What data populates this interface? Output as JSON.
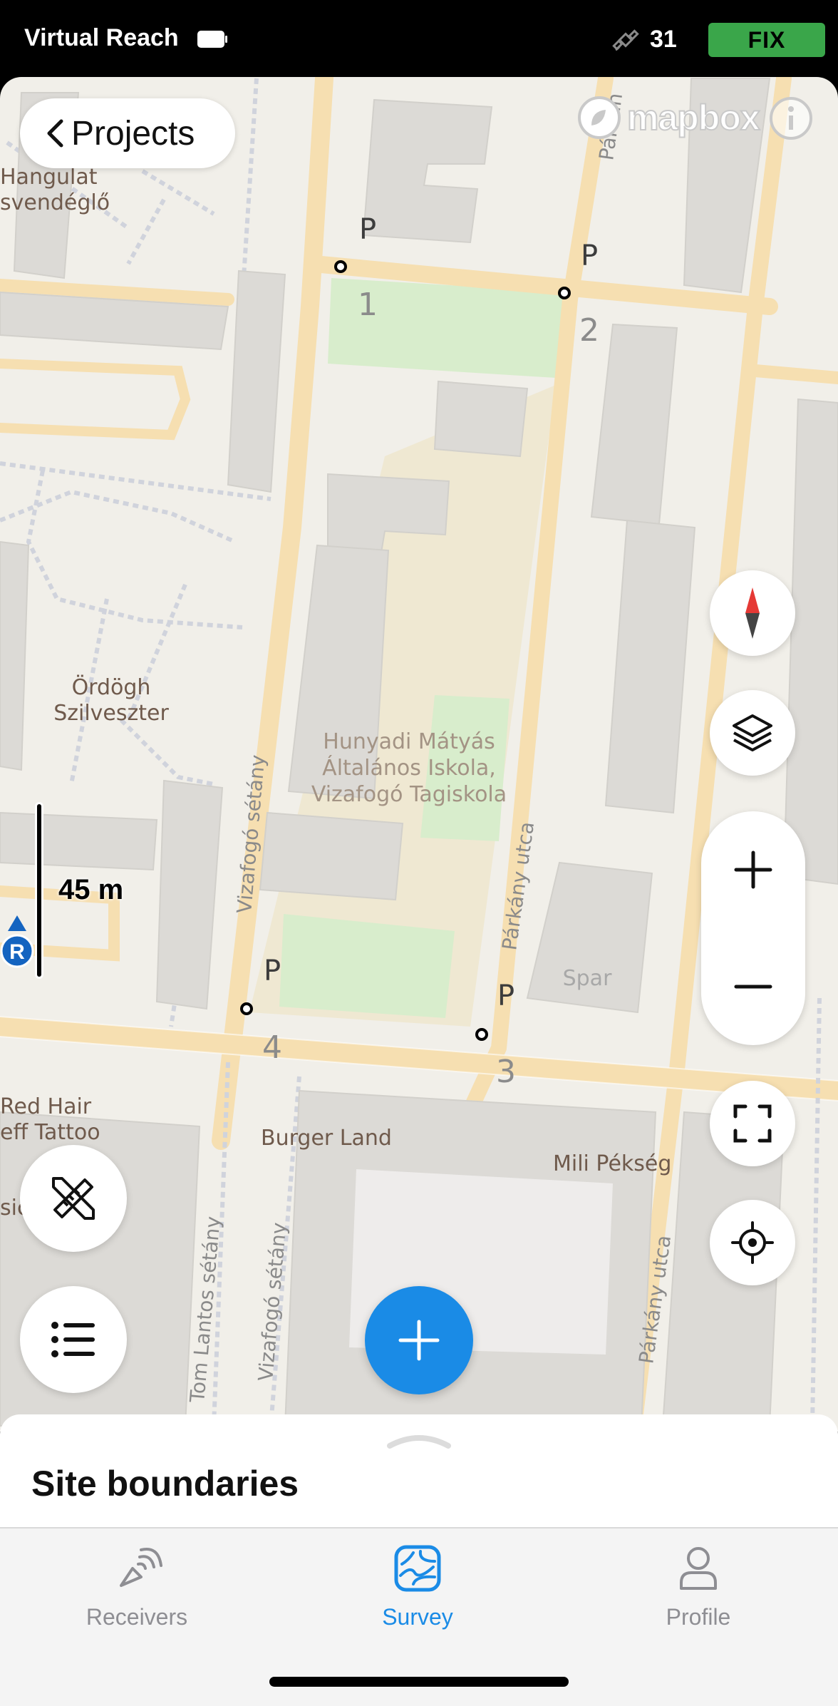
{
  "status_bar": {
    "device_name": "Virtual Reach",
    "satellite_count": "31",
    "fix_status": "FIX",
    "fix_color": "#3aa64a"
  },
  "map": {
    "back_button_label": "Projects",
    "attribution": "mapbox",
    "scale_label": "45 m",
    "rover_label": "R",
    "points": [
      {
        "number": "1",
        "marker": "P"
      },
      {
        "number": "2",
        "marker": "P"
      },
      {
        "number": "3",
        "marker": "P"
      },
      {
        "number": "4",
        "marker": "P"
      }
    ],
    "labels": {
      "poi_hangulat_1": "Hangulat",
      "poi_hangulat_2": "svendéglő",
      "poi_ordogh_1": "Ördögh",
      "poi_ordogh_2": "Szilveszter",
      "poi_school_1": "Hunyadi Mátyás",
      "poi_school_2": "Általános Iskola,",
      "poi_school_3": "Vizafogó Tagiskola",
      "poi_spar": "Spar",
      "poi_redhair_1": "Red Hair",
      "poi_redhair_2": "eff Tattoo",
      "poi_burgerland": "Burger Land",
      "poi_mili": "Mili Pékség",
      "poi_partial": "sic",
      "street_vizafogo_1": "Vizafogó sétány",
      "street_vizafogo_2": "Vizafogó sétány",
      "street_parkany_1": "Párkány utca",
      "street_parkany_2": "Párkány utca",
      "street_parkany_top": "Párkán",
      "street_tomlantos": "Tom Lantos sétány"
    },
    "accent_color": "#1a8be6"
  },
  "bottom_sheet": {
    "title": "Site boundaries"
  },
  "tab_bar": {
    "tabs": [
      {
        "label": "Receivers",
        "icon": "receiver-icon",
        "active": false
      },
      {
        "label": "Survey",
        "icon": "survey-icon",
        "active": true
      },
      {
        "label": "Profile",
        "icon": "profile-icon",
        "active": false
      }
    ]
  }
}
